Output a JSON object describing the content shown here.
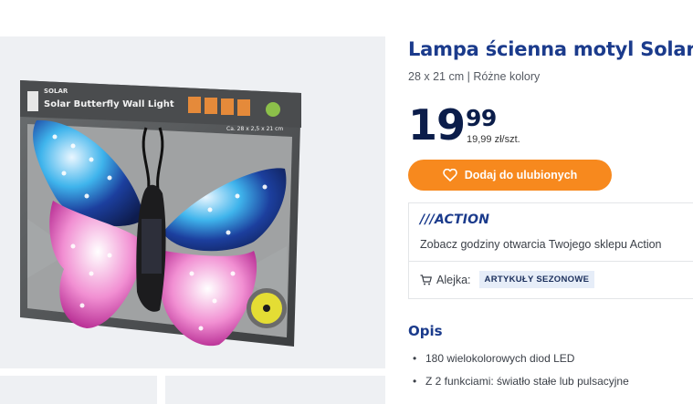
{
  "product": {
    "title": "Lampa ścienna motyl Solar",
    "subtitle": "28 x 21 cm | Różne kolory",
    "price_integer": "19",
    "price_decimal": "99",
    "unit_price": "19,99 zł/szt."
  },
  "actions": {
    "favorite_label": "Dodaj do ulubionych"
  },
  "store": {
    "logo_text": "///ACTION",
    "hours_text": "Zobacz godziny otwarcia Twojego sklepu Action",
    "aisle_label": "Alejka:",
    "aisle_value": "ARTYKUŁY SEZONOWE"
  },
  "description": {
    "title": "Opis",
    "bullets": [
      "180 wielokolorowych diod LED",
      "Z 2 funkciami: światło stałe lub pulsacyjne"
    ]
  },
  "packaging": {
    "brand": "SOLAR",
    "name": "Solar Butterfly Wall Light",
    "size": "Ca. 28 x 2,5 x 21 cm"
  },
  "colors": {
    "title": "#1b3b8c",
    "price": "#0b1d4a",
    "button": "#f7891e",
    "badge_bg": "#e6edf8",
    "panel_bg": "#eef0f3"
  },
  "icons": {
    "favorite": "heart-icon",
    "aisle": "cart-icon"
  }
}
